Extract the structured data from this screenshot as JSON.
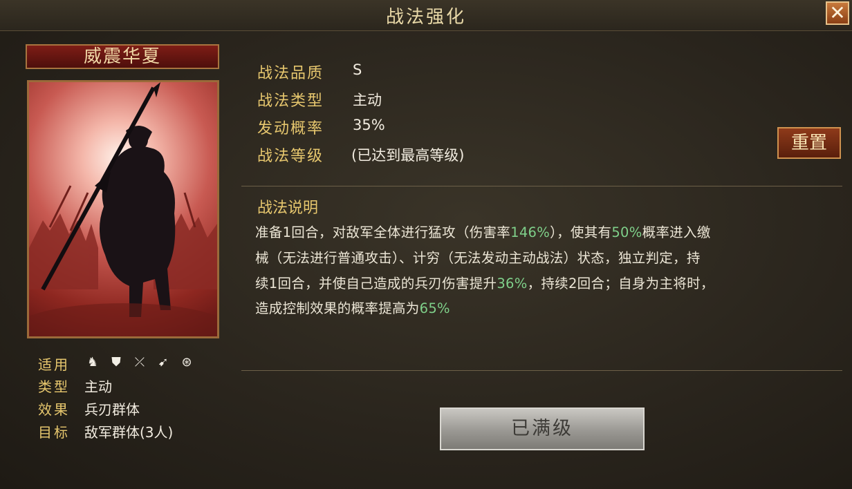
{
  "window": {
    "title": "战法强化",
    "close_label": "✕"
  },
  "card": {
    "name": "威震华夏"
  },
  "info": {
    "quality_label": "战法品质",
    "quality_value": "S",
    "type_label": "战法类型",
    "type_value": "主动",
    "rate_label": "发动概率",
    "rate_value": "35%",
    "level_label": "战法等级",
    "level_value": "(已达到最高等级)"
  },
  "reset_button": "重置",
  "description": {
    "title": "战法说明",
    "line1": {
      "t1": "准备1回合，对敌军全体进行猛攻（伤害率",
      "h1": "146%",
      "t2": "），使其有",
      "h2": "50%",
      "t3": "概率进入缴"
    },
    "line2": "械（无法进行普通攻击）、计穷（无法发动主动战法）状态，独立判定，持",
    "line3": {
      "t1": "续1回合，并使自己造成的兵刃伤害提升",
      "h1": "36%",
      "t2": "，持续2回合；自身为主将时，"
    },
    "line4": {
      "t1": "造成控制效果的概率提高为",
      "h1": "65%"
    }
  },
  "side": {
    "apply_label": "适用",
    "troop_icons": [
      "cavalry-icon",
      "shield-icon",
      "bow-icon",
      "spear-icon",
      "siege-icon"
    ],
    "type_label": "类型",
    "type_value": "主动",
    "effect_label": "效果",
    "effect_value": "兵刃群体",
    "target_label": "目标",
    "target_value": "敌军群体(3人)"
  },
  "max_button": "已满级",
  "colors": {
    "gold": "#e7c76e",
    "highlight": "#7fd08a",
    "accent_red": "#8e3a1a"
  }
}
